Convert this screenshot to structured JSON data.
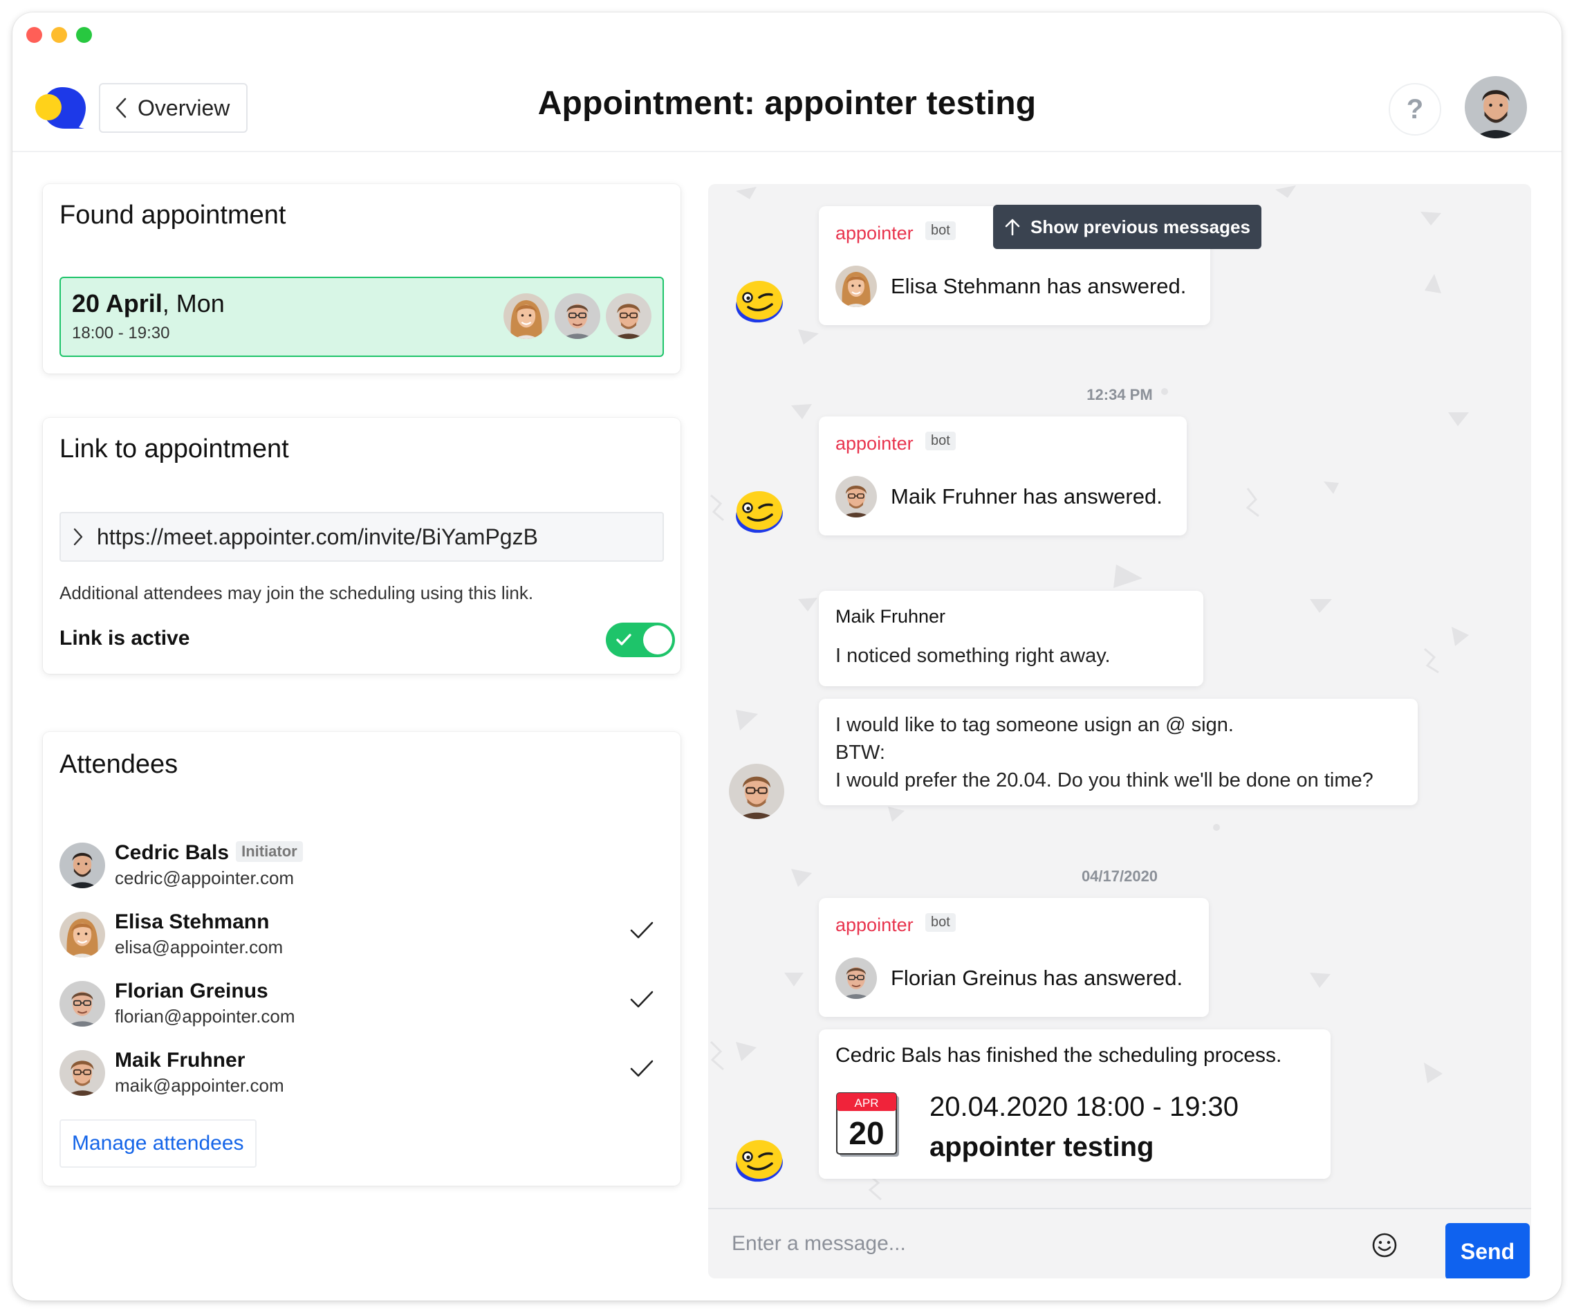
{
  "header": {
    "back_label": "Overview",
    "title": "Appointment: appointer testing",
    "help_label": "?"
  },
  "found": {
    "heading": "Found appointment",
    "date_bold": "20 April",
    "date_rest": ", Mon",
    "time": "18:00 - 19:30"
  },
  "link": {
    "heading": "Link to appointment",
    "url": "https://meet.appointer.com/invite/BiYamPgzB",
    "help": "Additional attendees may join the scheduling using this link.",
    "active_label": "Link is active"
  },
  "attendees": {
    "heading": "Attendees",
    "items": [
      {
        "name": "Cedric Bals",
        "email": "cedric@appointer.com",
        "badge": "Initiator"
      },
      {
        "name": "Elisa Stehmann",
        "email": "elisa@appointer.com"
      },
      {
        "name": "Florian Greinus",
        "email": "florian@appointer.com"
      },
      {
        "name": "Maik Fruhner",
        "email": "maik@appointer.com"
      }
    ],
    "manage_label": "Manage attendees"
  },
  "chat": {
    "show_previous": "Show previous messages",
    "bot_sender": "appointer",
    "bot_badge": "bot",
    "msg1": "Elisa Stehmann has answered.",
    "time1": "12:34 PM",
    "msg2": "Maik Fruhner has answered.",
    "user_sender": "Maik Fruhner",
    "msg3": "I noticed something right away.",
    "msg4_line1": "I would like to tag someone usign an @ sign.",
    "msg4_line2": "BTW:",
    "msg4_line3": "I would prefer the 20.04. Do you think we'll be done on time?",
    "time2": "04/17/2020",
    "msg5": "Florian Greinus has answered.",
    "msg6": "Cedric Bals has finished the scheduling process.",
    "cal_month": "APR",
    "cal_day": "20",
    "cal_range": "20.04.2020 18:00 - 19:30",
    "cal_title": "appointer testing"
  },
  "composer": {
    "placeholder": "Enter a message...",
    "send_label": "Send"
  },
  "colors": {
    "accent_blue": "#0f62ef",
    "success_green": "#1ec46a",
    "bot_red": "#e8344e"
  }
}
